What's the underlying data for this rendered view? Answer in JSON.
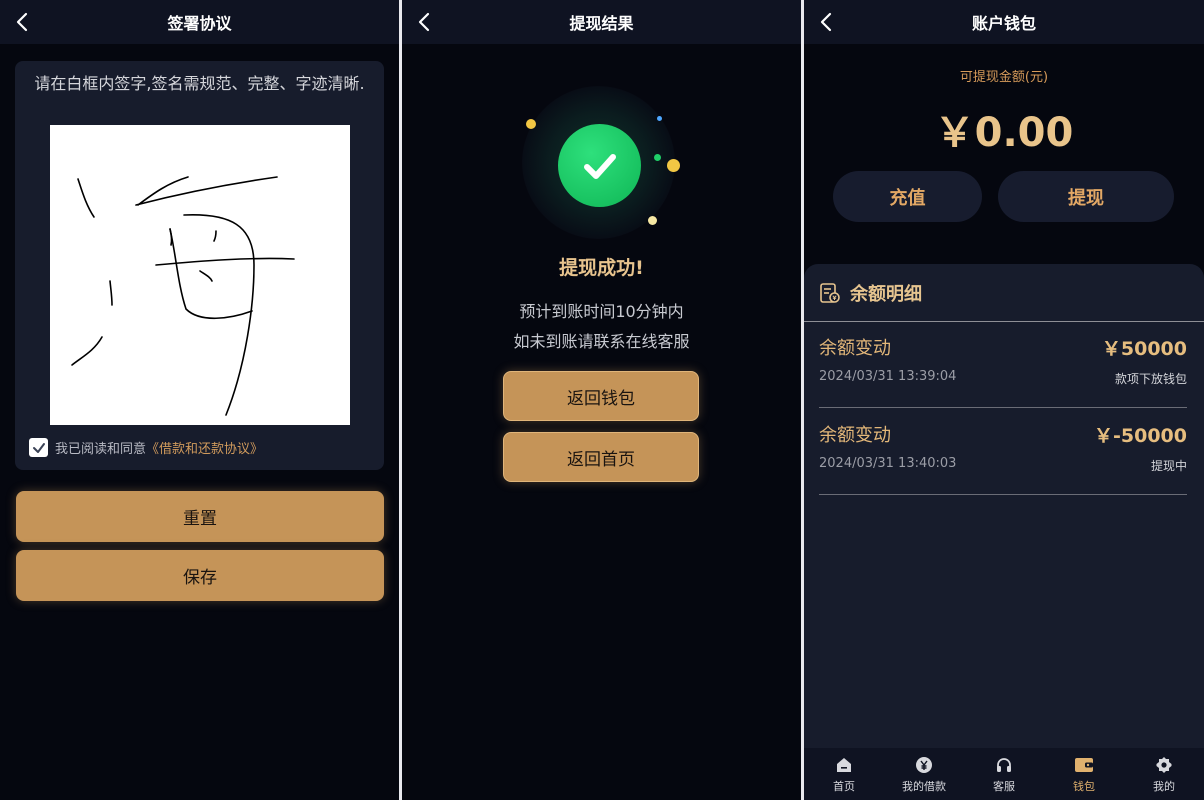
{
  "screen1": {
    "title": "签署协议",
    "instruction": "请在白框内签字,签名需规范、完整、字迹清晰.",
    "agree_text": "我已阅读和同意",
    "agree_link": "《借款和还款协议》",
    "agree_checked": true,
    "reset_label": "重置",
    "save_label": "保存"
  },
  "screen2": {
    "title": "提现结果",
    "success_title": "提现成功!",
    "line1": "预计到账时间10分钟内",
    "line2": "如未到账请联系在线客服",
    "back_wallet_label": "返回钱包",
    "back_home_label": "返回首页"
  },
  "screen3": {
    "title": "账户钱包",
    "available_label": "可提现金额(元)",
    "balance": "￥0.00",
    "recharge_label": "充值",
    "withdraw_label": "提现",
    "detail_title": "余额明细",
    "records": [
      {
        "name": "余额变动",
        "amount": "￥50000",
        "time": "2024/03/31 13:39:04",
        "status": "款项下放钱包"
      },
      {
        "name": "余额变动",
        "amount": "￥-50000",
        "time": "2024/03/31 13:40:03",
        "status": "提现中"
      }
    ],
    "tabs": [
      {
        "label": "首页",
        "icon": "home-icon"
      },
      {
        "label": "我的借款",
        "icon": "yuan-icon"
      },
      {
        "label": "客服",
        "icon": "headset-icon"
      },
      {
        "label": "钱包",
        "icon": "wallet-icon",
        "active": true
      },
      {
        "label": "我的",
        "icon": "gear-icon"
      }
    ]
  },
  "colors": {
    "background": "#05070f",
    "header": "#0f1322",
    "card": "#171c2c",
    "gold_button": "#c59458",
    "gold_text": "#e9c48b",
    "success_green": "#1fcf68"
  }
}
